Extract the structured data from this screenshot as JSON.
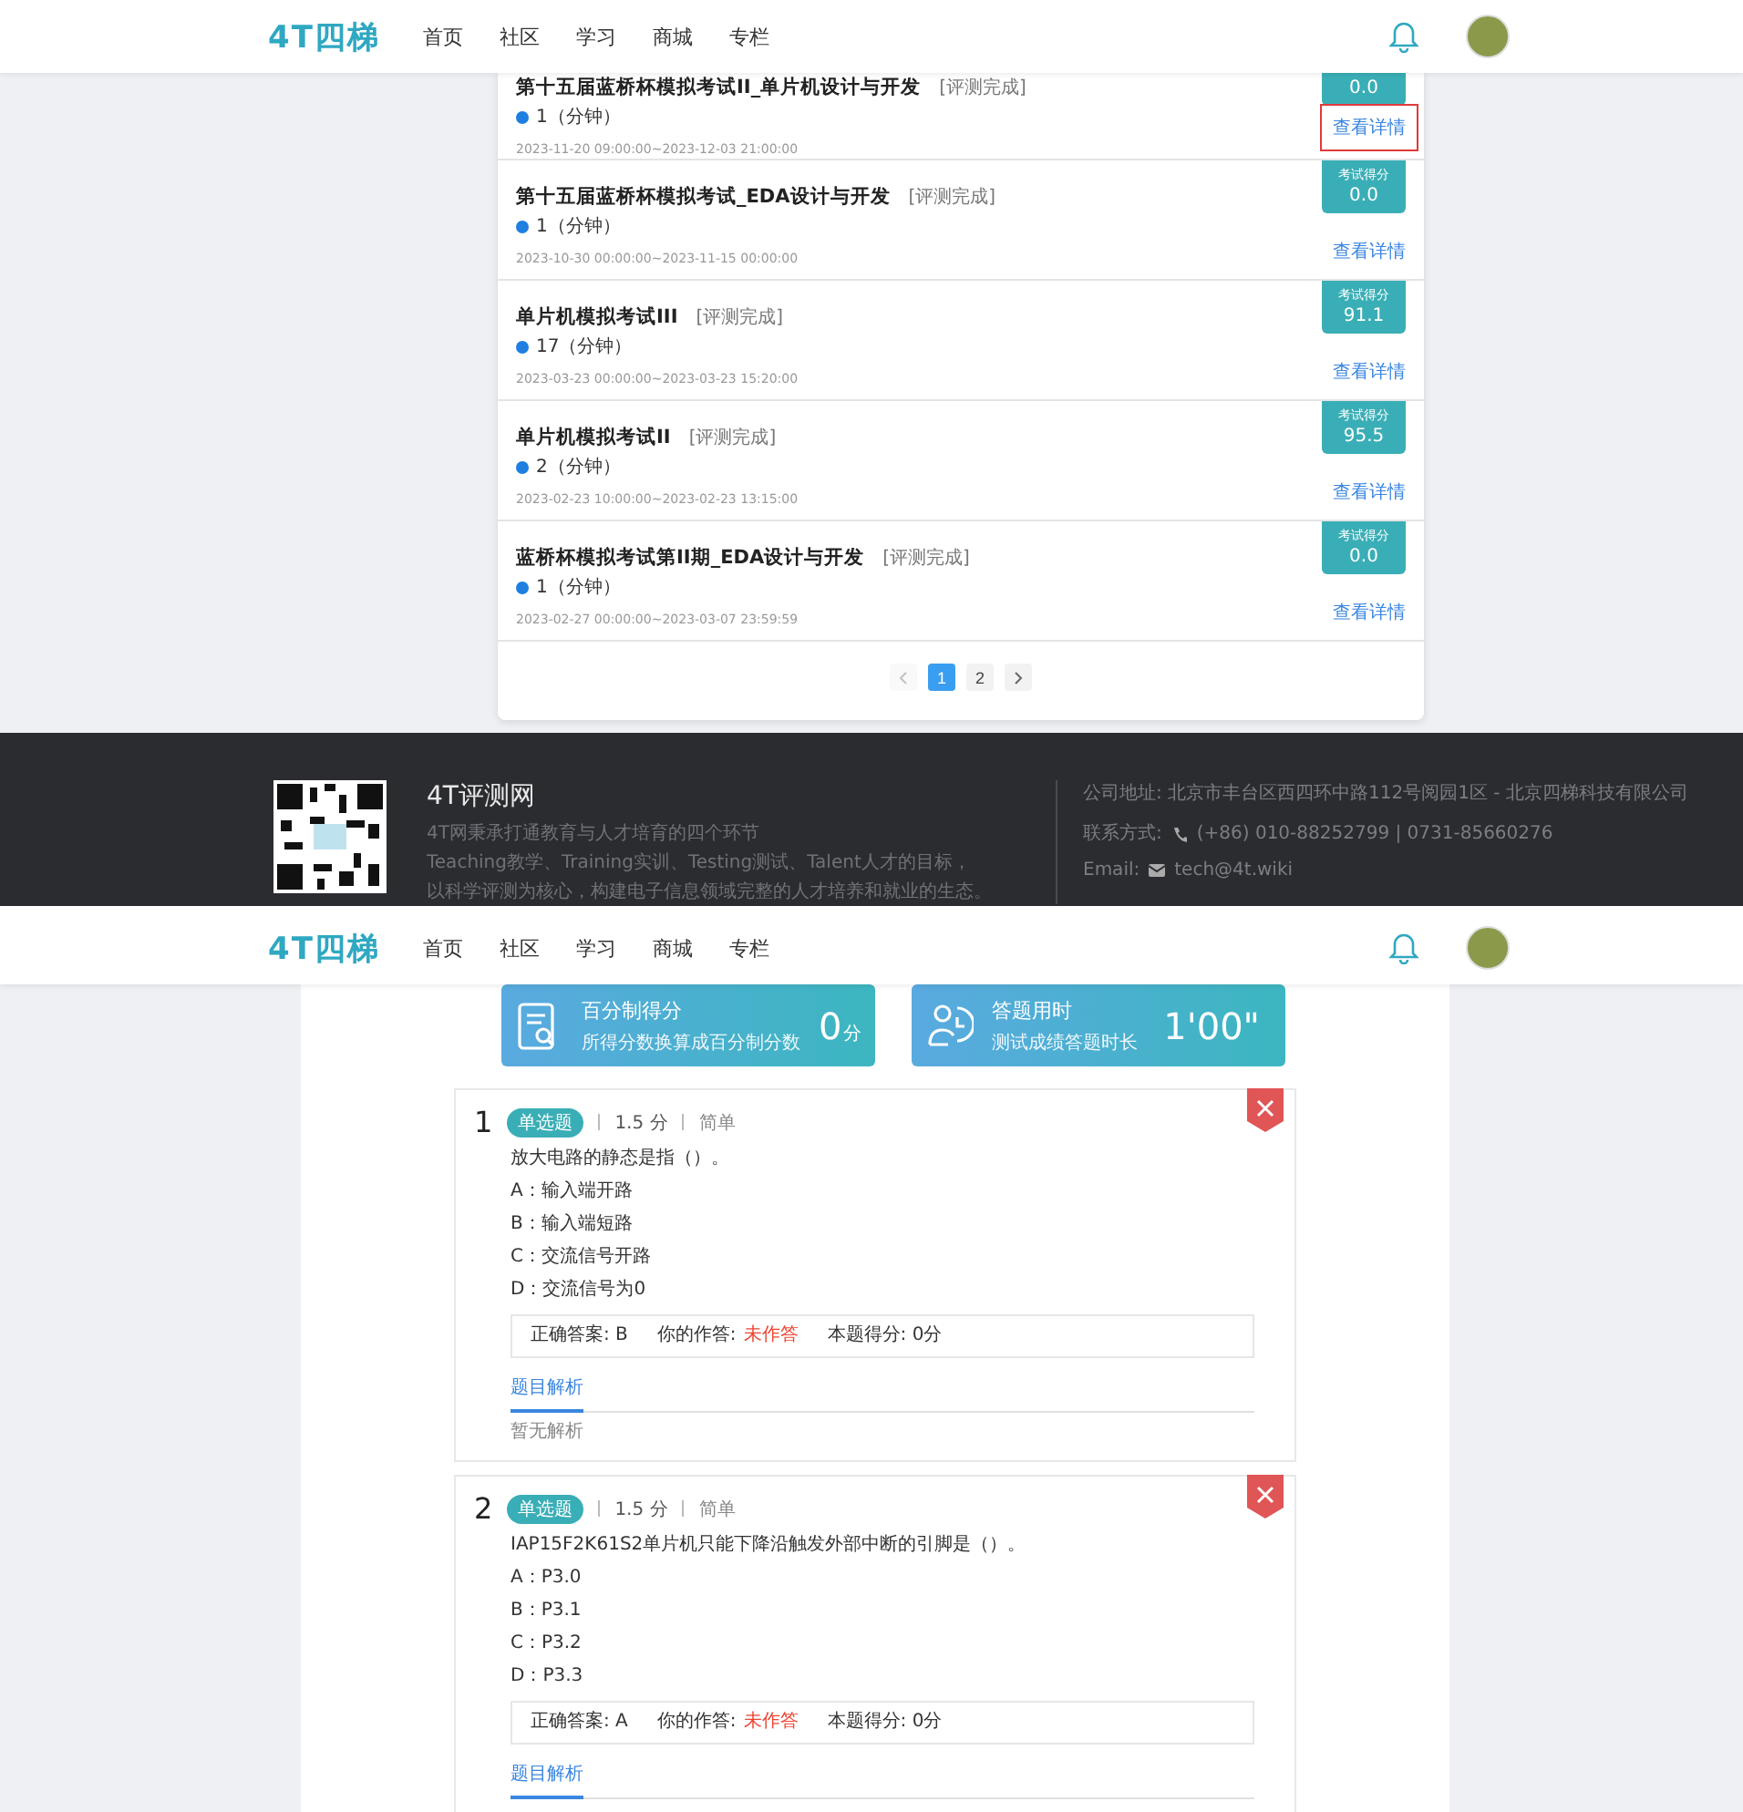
{
  "screens": [
    {
      "header": {
        "logo": "4T四梯",
        "nav": [
          "首页",
          "社区",
          "学习",
          "商城",
          "专栏"
        ]
      },
      "exam_list": {
        "items": [
          {
            "title": "第十五届蓝桥杯模拟考试II_单片机设计与开发",
            "status": "[评测完成]",
            "duration": "1（分钟）",
            "period": "2023-11-20 09:00:00~2023-12-03 21:00:00",
            "score": "0.0",
            "link": "查看详情",
            "highlighted": true
          },
          {
            "title": "第十五届蓝桥杯模拟考试_EDA设计与开发",
            "status": "[评测完成]",
            "duration": "1（分钟）",
            "period": "2023-10-30 00:00:00~2023-11-15 00:00:00",
            "score_label": "考试得分",
            "score": "0.0",
            "link": "查看详情",
            "highlighted": false
          },
          {
            "title": "单片机模拟考试III",
            "status": "[评测完成]",
            "duration": "17（分钟）",
            "period": "2023-03-23 00:00:00~2023-03-23 15:20:00",
            "score_label": "考试得分",
            "score": "91.1",
            "link": "查看详情",
            "highlighted": false
          },
          {
            "title": "单片机模拟考试II",
            "status": "[评测完成]",
            "duration": "2（分钟）",
            "period": "2023-02-23 10:00:00~2023-02-23 13:15:00",
            "score_label": "考试得分",
            "score": "95.5",
            "link": "查看详情",
            "highlighted": false
          },
          {
            "title": "蓝桥杯模拟考试第II期_EDA设计与开发",
            "status": "[评测完成]",
            "duration": "1（分钟）",
            "period": "2023-02-27 00:00:00~2023-03-07 23:59:59",
            "score_label": "考试得分",
            "score": "0.0",
            "link": "查看详情",
            "highlighted": false
          }
        ],
        "pagination": {
          "prev_disabled": true,
          "pages": [
            {
              "label": "1",
              "selected": true
            },
            {
              "label": "2",
              "selected": false
            }
          ]
        }
      },
      "footer": {
        "title": "4T评测网",
        "lines": [
          "4T网秉承打通教育与人才培育的四个环节",
          "Teaching教学、Training实训、Testing测试、Talent人才的目标，",
          "以科学评测为核心，构建电子信息领域完整的人才培养和就业的生态。"
        ],
        "address": "公司地址: 北京市丰台区西四环中路112号阅园1区 - 北京四梯科技有限公司",
        "contact_label": "联系方式:",
        "phone": "(+86) 010-88252799 | 0731-85660276",
        "email_label": "Email:",
        "email": "tech@4t.wiki"
      }
    },
    {
      "header": {
        "logo": "4T四梯",
        "nav": [
          "首页",
          "社区",
          "学习",
          "商城",
          "专栏"
        ]
      },
      "summary": [
        {
          "kind": "score",
          "title": "百分制得分",
          "subtitle": "所得分数换算成百分制分数",
          "value": "0",
          "unit": "分"
        },
        {
          "kind": "time",
          "title": "答题用时",
          "subtitle": "测试成绩答题时长",
          "value": "1'00\""
        }
      ],
      "questions": [
        {
          "number": "1",
          "type": "单选题",
          "points": "1.5 分",
          "difficulty": "简单",
          "correct": false,
          "stem": "放大电路的静态是指（）。",
          "options": [
            "A：输入端开路",
            "B：输入端短路",
            "C：交流信号开路",
            "D：交流信号为0"
          ],
          "correct_answer": "正确答案: B",
          "your_answer_label": "你的作答:",
          "your_answer": "未作答",
          "answered": false,
          "question_score": "本题得分: 0分",
          "tab": "题目解析",
          "analysis": "暂无解析"
        },
        {
          "number": "2",
          "type": "单选题",
          "points": "1.5 分",
          "difficulty": "简单",
          "correct": false,
          "stem": "IAP15F2K61S2单片机只能下降沿触发外部中断的引脚是（）。",
          "options": [
            "A：P3.0",
            "B：P3.1",
            "C：P3.2",
            "D：P3.3"
          ],
          "correct_answer": "正确答案: A",
          "your_answer_label": "你的作答:",
          "your_answer": "未作答",
          "answered": false,
          "question_score": "本题得分: 0分",
          "tab": "题目解析"
        }
      ]
    }
  ]
}
